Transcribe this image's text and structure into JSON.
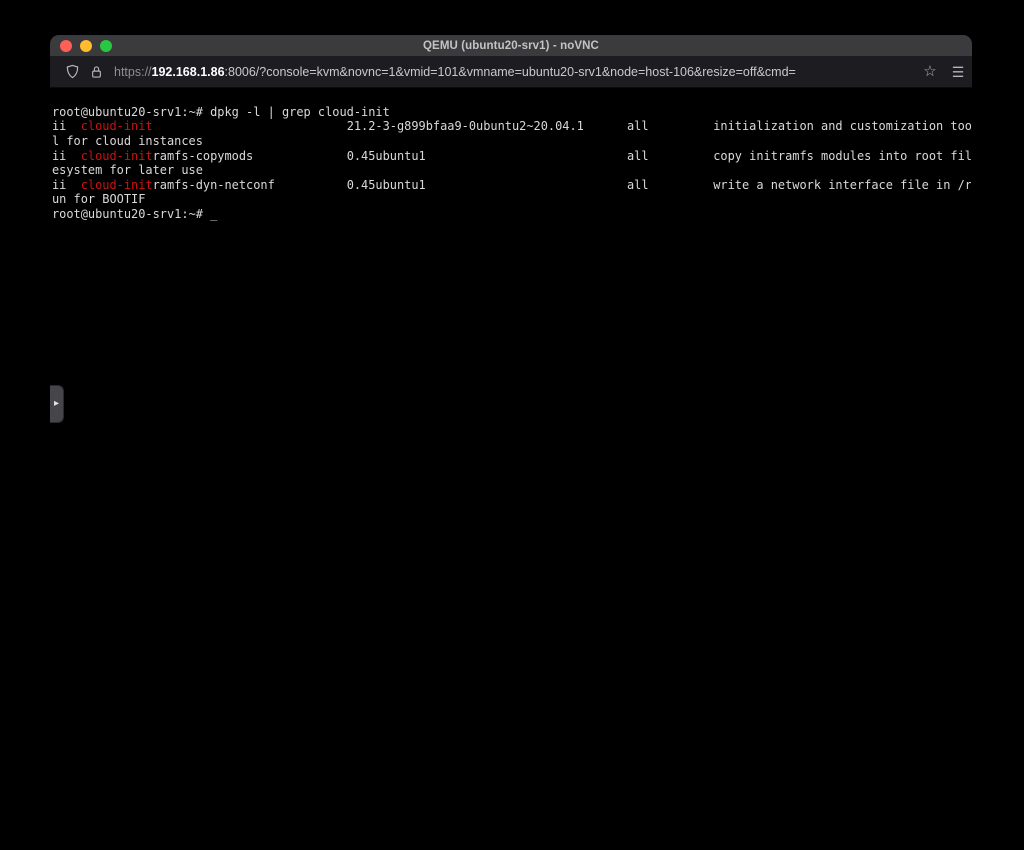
{
  "window": {
    "title": "QEMU (ubuntu20-srv1) - noVNC"
  },
  "browser": {
    "url": {
      "scheme": "https://",
      "domain": "192.168.1.86",
      "rest": ":8006/?console=kvm&novnc=1&vmid=101&vmname=ubuntu20-srv1&node=host-106&resize=off&cmd="
    },
    "icons": {
      "shield": "tracking-protection-shield",
      "lock": "connection-secure-lock",
      "bookmark": "bookmark-star",
      "menu": "application-menu"
    }
  },
  "traffic_lights": {
    "close": "#ff5f57",
    "minimize": "#febc2e",
    "zoom": "#28c840"
  },
  "novnc": {
    "handle_arrow": "▸"
  },
  "colors": {
    "terminal_fg": "#d9d9d9",
    "grep_match": "#cc1111",
    "terminal_bg": "#000000",
    "titlebar_bg": "#3b3b3e",
    "navbar_bg": "#1d1d21"
  },
  "terminal": {
    "lines": [
      {
        "segments": [
          {
            "t": "root@ubuntu20-srv1:~# dpkg -l | grep cloud-init",
            "c": "fg"
          }
        ]
      },
      {
        "segments": [
          {
            "t": "ii  ",
            "c": "fg"
          },
          {
            "t": "cloud-init",
            "c": "red"
          },
          {
            "t": "21.2-3-g899bfaa9-0ubuntu2~20.04.1",
            "c": "fg",
            "col": 41
          },
          {
            "t": "all",
            "c": "fg",
            "col": 80
          },
          {
            "t": "initialization and customization too",
            "c": "fg",
            "col": 92
          }
        ]
      },
      {
        "segments": [
          {
            "t": "l for cloud instances",
            "c": "fg"
          }
        ]
      },
      {
        "segments": [
          {
            "t": "ii  ",
            "c": "fg"
          },
          {
            "t": "cloud-init",
            "c": "red"
          },
          {
            "t": "ramfs-copymods",
            "c": "fg"
          },
          {
            "t": "0.45ubuntu1",
            "c": "fg",
            "col": 41
          },
          {
            "t": "all",
            "c": "fg",
            "col": 80
          },
          {
            "t": "copy initramfs modules into root fil",
            "c": "fg",
            "col": 92
          }
        ]
      },
      {
        "segments": [
          {
            "t": "esystem for later use",
            "c": "fg"
          }
        ]
      },
      {
        "segments": [
          {
            "t": "ii  ",
            "c": "fg"
          },
          {
            "t": "cloud-init",
            "c": "red"
          },
          {
            "t": "ramfs-dyn-netconf",
            "c": "fg"
          },
          {
            "t": "0.45ubuntu1",
            "c": "fg",
            "col": 41
          },
          {
            "t": "all",
            "c": "fg",
            "col": 80
          },
          {
            "t": "write a network interface file in /r",
            "c": "fg",
            "col": 92
          }
        ]
      },
      {
        "segments": [
          {
            "t": "un for BOOTIF",
            "c": "fg"
          }
        ]
      },
      {
        "segments": [
          {
            "t": "root@ubuntu20-srv1:~# ",
            "c": "fg"
          },
          {
            "t": "_",
            "c": "cursor"
          }
        ]
      }
    ]
  }
}
